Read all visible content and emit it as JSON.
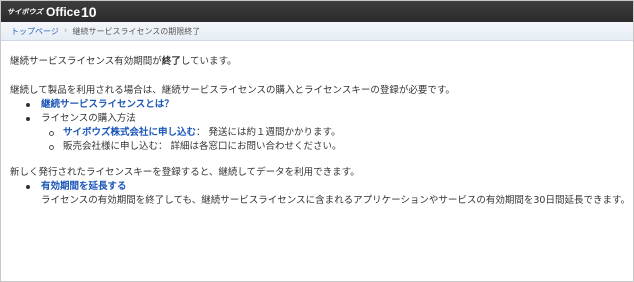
{
  "header": {
    "maker": "サイボウズ",
    "product": "Office",
    "version": "10"
  },
  "breadcrumb": {
    "home": "トップページ",
    "current": "継続サービスライセンスの期限終了"
  },
  "main": {
    "p1_prefix": "継続サービスライセンス有効期間が",
    "p1_bold": "終了",
    "p1_suffix": "しています。",
    "p2": "継続して製品を利用される場合は、継続サービスライセンスの購入とライセンスキーの登録が必要です。",
    "list1": {
      "item1_link": "継続サービスライセンスとは？",
      "item2": "ライセンスの購入方法",
      "sub1_link": "サイボウズ株式会社に申し込む",
      "sub1_text": "：  発送には約１週間かかります。",
      "sub2": "販売会社様に申し込む：  詳細は各窓口にお問い合わせください。"
    },
    "p3": "新しく発行されたライセンスキーを登録すると、継続してデータを利用できます。",
    "list2": {
      "item1_link": "有効期間を延長する",
      "item1_desc": "ライセンスの有効期間を終了しても、継続サービスライセンスに含まれるアプリケーションやサービスの有効期間を30日間延長できます。"
    }
  },
  "colors": {
    "header_bg": "#333333",
    "link": "#1a55b8",
    "breadcrumb_link": "#2a62b8"
  }
}
